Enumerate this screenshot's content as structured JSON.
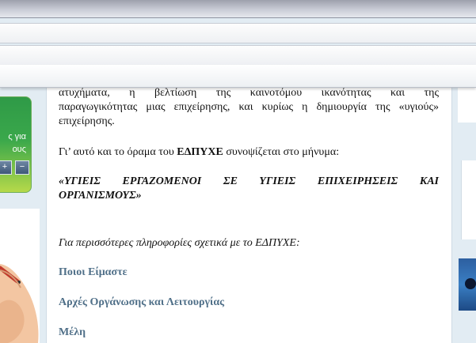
{
  "left_widget": {
    "line1": "ς για",
    "line2": "ους",
    "btn_plus": "+",
    "btn_minus": "−"
  },
  "main": {
    "paragraph1_line1": "ατυχήματα, η βελτίωση της καινοτόμου ικανότητας και της",
    "paragraph1_line2": "παραγωγικότητας μιας επιχείρησης, και κυρίως η δημιουργία της «υγιούς»",
    "paragraph1_line3": "επιχείρησης.",
    "paragraph2_before": "Γι’ αυτό και το όραμα του ",
    "paragraph2_bold": "ΕΔΠΥΧΕ",
    "paragraph2_after": " συνοψίζεται στο μήνυμα:",
    "slogan": "«ΥΓΙΕΙΣ ΕΡΓΑΖΟΜΕΝΟΙ ΣΕ ΥΓΙΕΙΣ ΕΠΙΧΕΙΡΗΣΕΙΣ ΚΑΙ ΟΡΓΑΝΙΣΜΟΥΣ»",
    "more_info": "Για περισσότερες πληροφορίες σχετικά με το ΕΔΠΥΧΕ:",
    "links": [
      "Ποιοι Είμαστε",
      "Αρχές Οργάνωσης και Λειτουργίας",
      "Μέλη"
    ]
  },
  "colors": {
    "link": "#4f6f88",
    "page_bg": "#e2ecf3",
    "widget_green": "#3aa84b"
  }
}
